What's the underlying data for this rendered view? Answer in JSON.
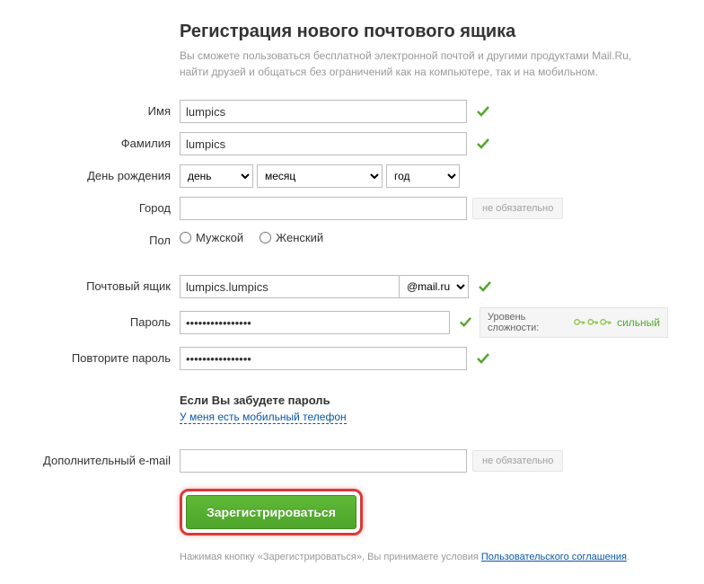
{
  "header": {
    "title": "Регистрация нового почтового ящика",
    "subtitle": "Вы сможете пользоваться бесплатной электронной почтой и другими продуктами Mail.Ru, найти друзей и общаться без ограничений как на компьютере, так и на мобильном."
  },
  "labels": {
    "firstname": "Имя",
    "lastname": "Фамилия",
    "birthday": "День рождения",
    "city": "Город",
    "gender": "Пол",
    "mailbox": "Почтовый ящик",
    "password": "Пароль",
    "password_repeat": "Повторите пароль",
    "extra_email": "Дополнительный e-mail"
  },
  "values": {
    "firstname": "lumpics",
    "lastname": "lumpics",
    "city": "",
    "mailbox": "lumpics.lumpics",
    "domain": "@mail.ru",
    "password": "••••••••••••••••",
    "password_repeat": "••••••••••••••••",
    "extra_email": ""
  },
  "birthday": {
    "day": "день",
    "month": "месяц",
    "year": "год"
  },
  "gender": {
    "male": "Мужской",
    "female": "Женский"
  },
  "hints": {
    "optional": "не обязательно"
  },
  "strength": {
    "label": "Уровень сложности:",
    "value": "сильный"
  },
  "forgot": {
    "header": "Если Вы забудете пароль",
    "mobile_link": "У меня есть мобильный телефон"
  },
  "submit": {
    "label": "Зарегистрироваться"
  },
  "footer": {
    "text": "Нажимая кнопку «Зарегистрироваться», Вы принимаете условия ",
    "link": "Пользовательского соглашения",
    "period": "."
  }
}
